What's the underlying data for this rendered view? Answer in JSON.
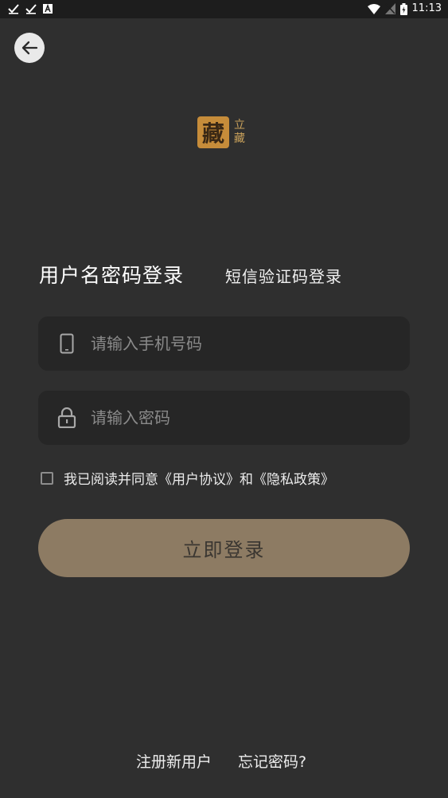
{
  "status_bar": {
    "time": "11:13",
    "left_icons": [
      "check-icon",
      "check-icon",
      "text-a-icon"
    ],
    "right_icons": [
      "wifi-icon",
      "signal-muted-icon",
      "battery-charging-icon"
    ]
  },
  "back_button": {
    "icon": "arrow-left-icon"
  },
  "logo": {
    "seal_char": "藏",
    "side_top": "立",
    "side_bottom": "藏"
  },
  "tabs": {
    "active": "用户名密码登录",
    "inactive": "短信验证码登录"
  },
  "phone_field": {
    "icon": "phone-icon",
    "placeholder": "请输入手机号码",
    "value": ""
  },
  "password_field": {
    "icon": "lock-icon",
    "placeholder": "请输入密码",
    "value": ""
  },
  "agreement": {
    "checked": false,
    "text": "我已阅读并同意《用户协议》和《隐私政策》"
  },
  "login_button": {
    "label": "立即登录"
  },
  "footer": {
    "register": "注册新用户",
    "forgot": "忘记密码?"
  },
  "colors": {
    "background": "#2f2f2f",
    "field_background": "#262626",
    "button_background": "#8d7b63",
    "logo_gold": "#c68c3a"
  }
}
